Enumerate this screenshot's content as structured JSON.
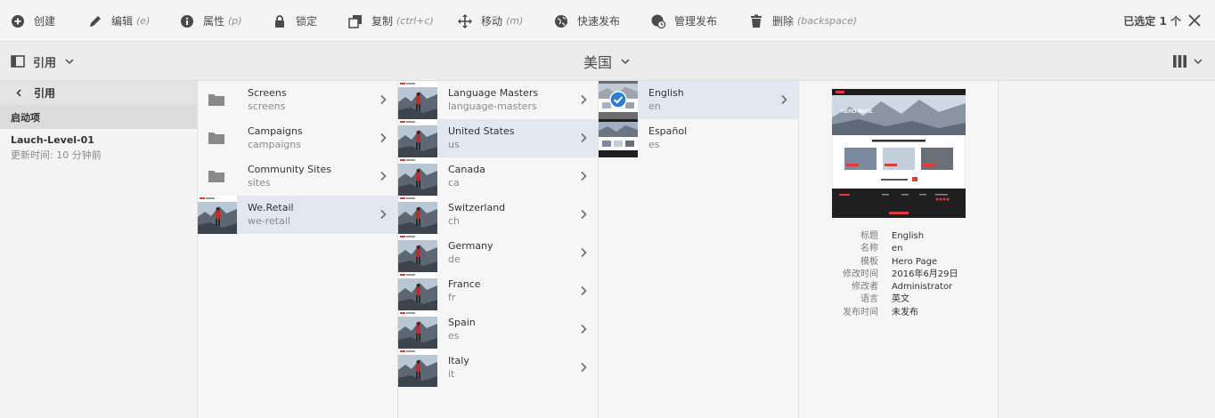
{
  "toolbar": {
    "create": "创建",
    "edit": "编辑",
    "edit_key": "(e)",
    "properties": "属性",
    "properties_key": "(p)",
    "lock": "锁定",
    "copy": "复制",
    "copy_key": "(ctrl+c)",
    "move": "移动",
    "move_key": "(m)",
    "quick_publish": "快速发布",
    "manage_publish": "管理发布",
    "delete": "删除",
    "delete_key": "(backspace)",
    "selected_count": "已选定 1 个"
  },
  "subbar": {
    "rail_label": "引用",
    "title": "美国"
  },
  "rail": {
    "back_label": "引用",
    "section": "启动项",
    "item_name": "Lauch-Level-01",
    "item_time": "更新时间: 10 分钟前"
  },
  "columns": [
    [
      {
        "title": "Screens",
        "name": "screens",
        "kind": "folder"
      },
      {
        "title": "Campaigns",
        "name": "campaigns",
        "kind": "folder"
      },
      {
        "title": "Community Sites",
        "name": "sites",
        "kind": "folder"
      },
      {
        "title": "We.Retail",
        "name": "we-retail",
        "kind": "thumb",
        "selected": true
      }
    ],
    [
      {
        "title": "Language Masters",
        "name": "language-masters",
        "kind": "thumb"
      },
      {
        "title": "United States",
        "name": "us",
        "kind": "thumb",
        "selected": true
      },
      {
        "title": "Canada",
        "name": "ca",
        "kind": "thumb"
      },
      {
        "title": "Switzerland",
        "name": "ch",
        "kind": "thumb"
      },
      {
        "title": "Germany",
        "name": "de",
        "kind": "thumb"
      },
      {
        "title": "France",
        "name": "fr",
        "kind": "thumb"
      },
      {
        "title": "Spain",
        "name": "es",
        "kind": "thumb"
      },
      {
        "title": "Italy",
        "name": "it",
        "kind": "thumb"
      }
    ],
    [
      {
        "title": "English",
        "name": "en",
        "kind": "page-checked",
        "selected": true
      },
      {
        "title": "Español",
        "name": "es",
        "kind": "page"
      }
    ]
  ],
  "preview": {
    "hero_text": "HERO PAGE",
    "meta": [
      {
        "k": "标题",
        "v": "English"
      },
      {
        "k": "名称",
        "v": "en"
      },
      {
        "k": "模板",
        "v": "Hero Page"
      },
      {
        "k": "修改时间",
        "v": "2016年6月29日"
      },
      {
        "k": "修改者",
        "v": "Administrator"
      },
      {
        "k": "语言",
        "v": "英文"
      },
      {
        "k": "发布时间",
        "v": "未发布"
      }
    ]
  },
  "colors": {
    "selected_row": "#e3e7ef",
    "accent_red": "#e03a3a",
    "check_blue": "#2d7cd6"
  }
}
